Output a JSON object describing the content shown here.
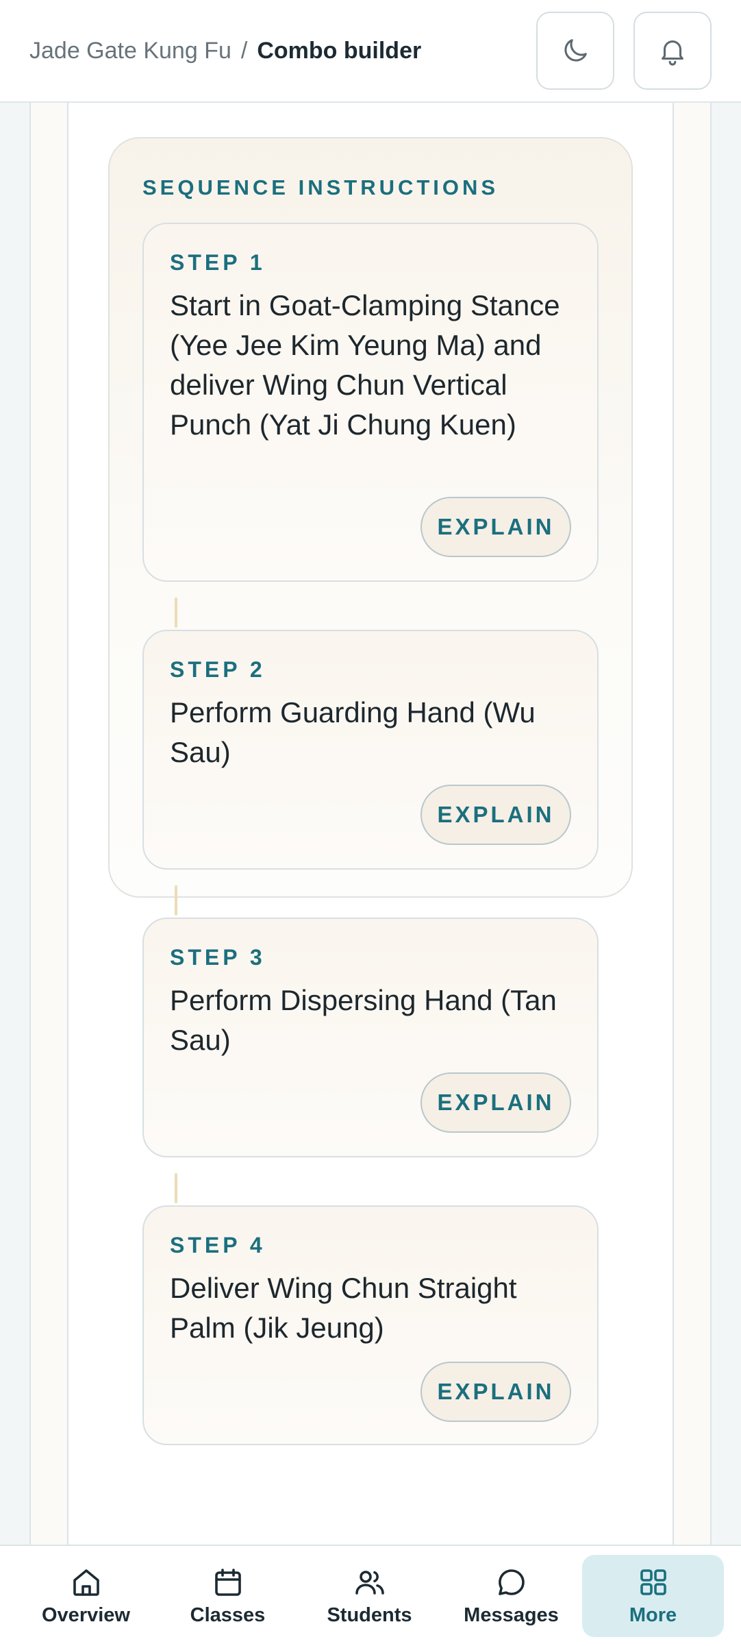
{
  "header": {
    "breadcrumb_root": "Jade Gate Kung Fu",
    "breadcrumb_separator": "/",
    "breadcrumb_current": "Combo builder",
    "theme_toggle_icon": "moon-icon",
    "notifications_icon": "bell-icon"
  },
  "sequence": {
    "title": "SEQUENCE INSTRUCTIONS",
    "explain_label": "EXPLAIN",
    "steps": [
      {
        "label": "STEP 1",
        "text": "Start in Goat-Clamping Stance (Yee Jee Kim Yeung Ma) and deliver Wing Chun Vertical Punch (Yat Ji Chung Kuen)"
      },
      {
        "label": "STEP 2",
        "text": "Perform Guarding Hand (Wu Sau)"
      },
      {
        "label": "STEP 3",
        "text": "Perform Dispersing Hand (Tan Sau)"
      },
      {
        "label": "STEP 4",
        "text": "Deliver Wing Chun Straight Palm (Jik Jeung)"
      }
    ]
  },
  "bottom_nav": {
    "items": [
      {
        "label": "Overview",
        "icon": "home-icon"
      },
      {
        "label": "Classes",
        "icon": "calendar-icon"
      },
      {
        "label": "Students",
        "icon": "users-icon"
      },
      {
        "label": "Messages",
        "icon": "chat-icon"
      },
      {
        "label": "More",
        "icon": "grid-icon",
        "active": true
      }
    ]
  },
  "colors": {
    "accent": "#1b6f7e",
    "active_nav_bg": "#d9edf1",
    "connector": "#ecdcb7"
  }
}
